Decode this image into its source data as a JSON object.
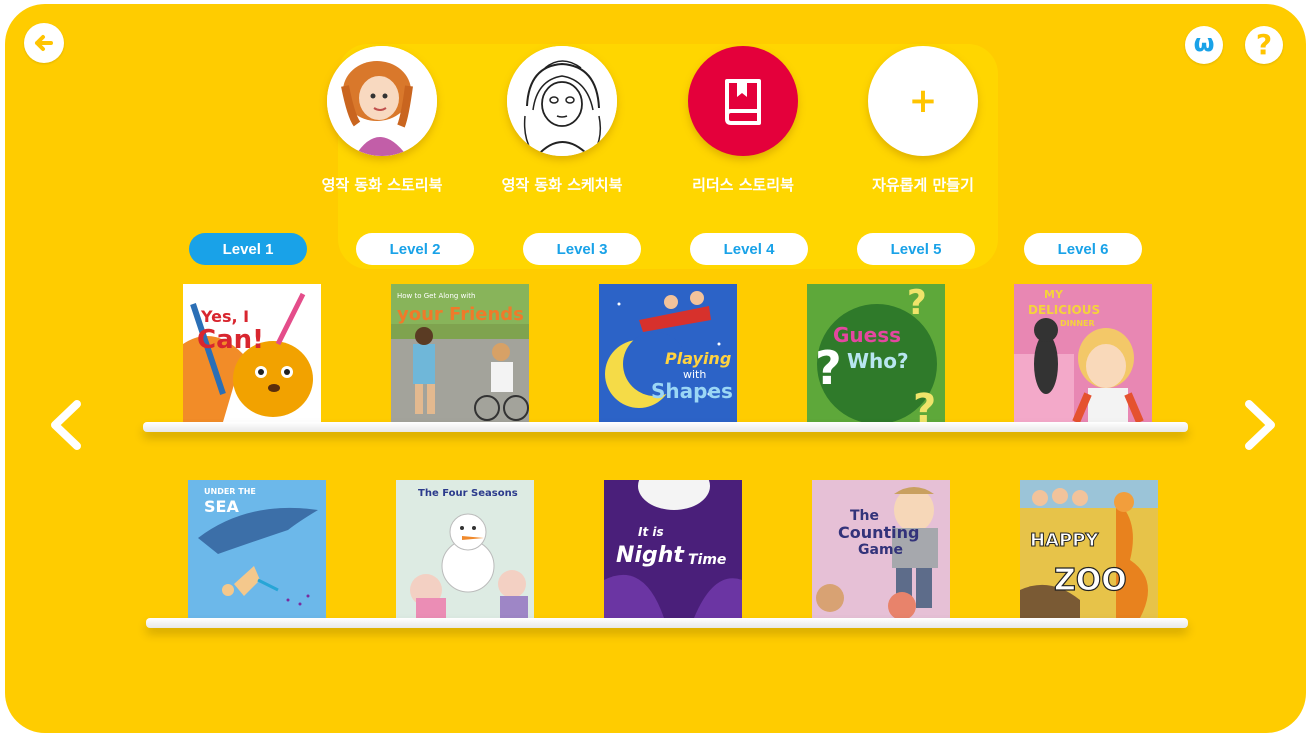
{
  "header": {
    "back_icon": "arrow-left-icon",
    "w_icon_glyph": "ω",
    "help_icon_glyph": "?",
    "colors": {
      "background": "#FFCC00",
      "accent_blue": "#19A2E8",
      "book_red": "#E4003B"
    }
  },
  "modes": [
    {
      "label": "영작 동화 스토리북",
      "icon": "girl-portrait"
    },
    {
      "label": "영작 동화 스케치북",
      "icon": "sketch-girl-portrait"
    },
    {
      "label": "리더스 스토리북",
      "icon": "book-icon"
    },
    {
      "label": "자유롭게 만들기",
      "icon": "plus-icon",
      "glyph": "+"
    }
  ],
  "levels": [
    {
      "label": "Level 1",
      "active": true
    },
    {
      "label": "Level 2",
      "active": false
    },
    {
      "label": "Level 3",
      "active": false
    },
    {
      "label": "Level 4",
      "active": false
    },
    {
      "label": "Level 5",
      "active": false
    },
    {
      "label": "Level 6",
      "active": false
    }
  ],
  "shelves": [
    {
      "books": [
        {
          "title": "Yes, I Can!",
          "t1": "Yes, I",
          "t2": "Can!"
        },
        {
          "title": "How to Get Along with Your Friends",
          "t1": "How to Get Along with",
          "t2": "your Friends"
        },
        {
          "title": "Playing with Shapes",
          "t1": "Playing",
          "t2": "with",
          "t3": "Shapes"
        },
        {
          "title": "Guess Who?",
          "t1": "Guess",
          "t2": "Who?"
        },
        {
          "title": "My Delicious Dinner",
          "t1": "MY",
          "t2": "DELICIOUS",
          "t3": "DINNER"
        }
      ]
    },
    {
      "books": [
        {
          "title": "Under the Sea",
          "t1": "UNDER THE",
          "t2": "SEA"
        },
        {
          "title": "The Four Seasons",
          "t1": "The Four Seasons"
        },
        {
          "title": "It is Night Time",
          "t1": "It is",
          "t2": "Night",
          "t3": "Time"
        },
        {
          "title": "The Counting Game",
          "t1": "The",
          "t2": "Counting",
          "t3": "Game"
        },
        {
          "title": "Happy Zoo",
          "t1": "HAPPY",
          "t2": "ZOO"
        }
      ]
    }
  ],
  "nav": {
    "prev_icon": "chevron-left-icon",
    "next_icon": "chevron-right-icon"
  }
}
